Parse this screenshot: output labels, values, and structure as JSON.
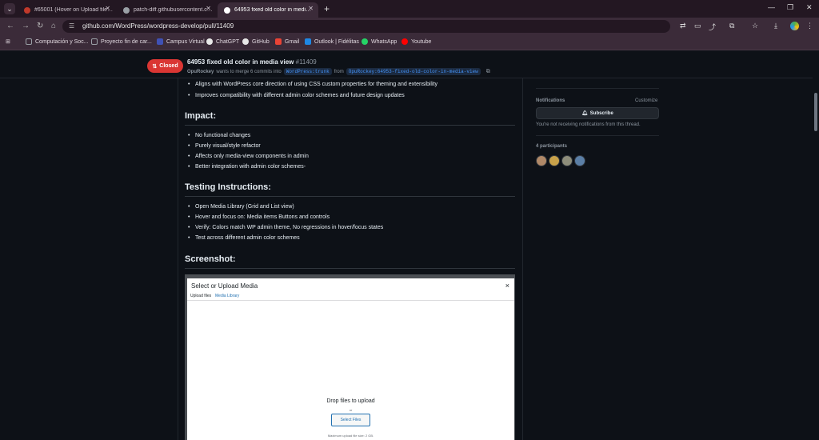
{
  "browser": {
    "tabs": [
      {
        "title": "#65001 (Hover on Upload files ...",
        "favicon_color": "#c0392b"
      },
      {
        "title": "patch-diff.githubusercontent.co...",
        "favicon_color": "#9aa0a6"
      },
      {
        "title": "64953 fixed old color in media v...",
        "favicon_color": "#ffffff"
      }
    ],
    "url": "github.com/WordPress/wordpress-develop/pull/11409",
    "bookmarks": [
      {
        "label": "Computación y Soc...",
        "color": "#9aa0a6"
      },
      {
        "label": "Proyecto fin de car...",
        "color": "#9aa0a6"
      },
      {
        "label": "Campus Virtual",
        "color": "#3f51b5"
      },
      {
        "label": "ChatGPT",
        "color": "#e8e8e8"
      },
      {
        "label": "GitHub",
        "color": "#e8e8e8"
      },
      {
        "label": "Gmail",
        "color": "#ea4335"
      },
      {
        "label": "Outlook | Fidélitas",
        "color": "#1e88e5"
      },
      {
        "label": "WhatsApp",
        "color": "#25d366"
      },
      {
        "label": "Youtube",
        "color": "#ff0000"
      }
    ]
  },
  "pr": {
    "state": "Closed",
    "title": "64953 fixed old color in media view",
    "number": "#11409",
    "author": "OpuRockey",
    "meta_text": "wants to merge 6 commits into",
    "base_branch": "WordPress:trunk",
    "from_text": "from",
    "head_branch": "OpuRockey:64953-fixed-old-color-in-media-view"
  },
  "body": {
    "top_bullets": [
      "Aligns with WordPress core direction of using CSS custom properties for theming and extensibility",
      "Improves compatibility with different admin color schemes and future design updates"
    ],
    "impact_heading": "Impact:",
    "impact_bullets": [
      "No functional changes",
      "Purely visual/style refactor",
      "Affects only media-view components in admin",
      "Better integration with admin color schemes-"
    ],
    "testing_heading": "Testing Instructions:",
    "testing_bullets": [
      "Open Media Library (Grid and List view)",
      "Hover and focus on: Media items Buttons and controls",
      "Verify: Colors match WP admin theme, No regressions in hover/focus states",
      "Test across different admin color schemes"
    ],
    "screenshot_heading": "Screenshot:"
  },
  "sidebar": {
    "notifications_label": "Notifications",
    "customize_label": "Customize",
    "subscribe_label": "Subscribe",
    "notification_note": "You're not receiving notifications from this thread.",
    "participants_label": "4 participants",
    "participant_colors": [
      "#b08968",
      "#c9a24a",
      "#8d8d7a",
      "#5b7fa6"
    ]
  },
  "modal": {
    "title": "Select or Upload Media",
    "close": "×",
    "tab_upload": "Upload files",
    "tab_library": "Media Library",
    "drop_text": "Drop files to upload",
    "or_text": "or",
    "select_button": "Select Files",
    "max_text": "Maximum upload file size: 2 GB."
  }
}
